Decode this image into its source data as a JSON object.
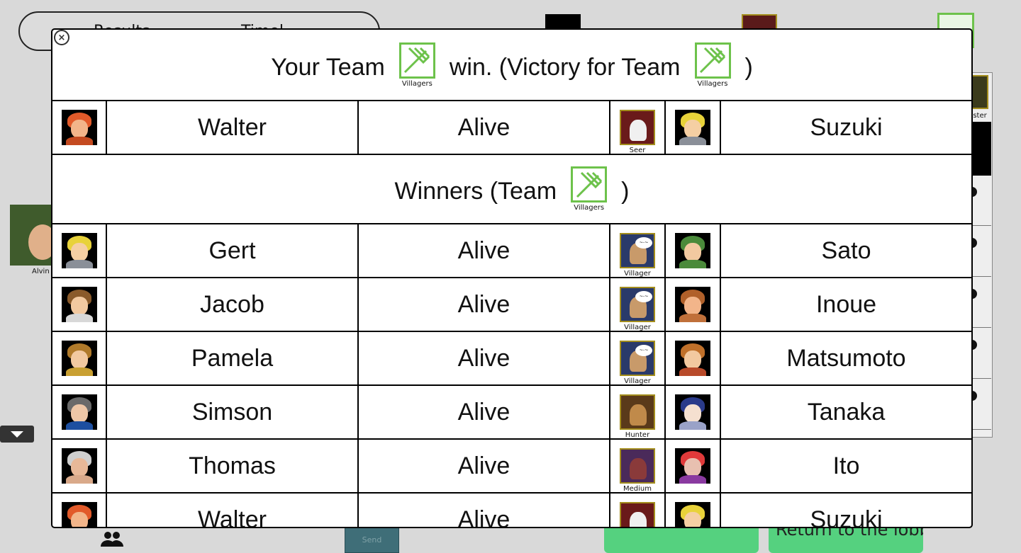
{
  "background": {
    "tabs": [
      "Results",
      "Timel"
    ],
    "side_player": "Alvin",
    "right_label": "nster",
    "send_label": "Send",
    "return_label": "Return to the lobby"
  },
  "modal": {
    "close_icon": "close-icon",
    "your_team_text": "Your Team",
    "win_text": "win. (Victory for Team",
    "close_paren": ")",
    "team_name": "Villagers",
    "winners_text": "Winners (Team",
    "team_color": "#6dc24b"
  },
  "player_rows": [
    {
      "name": "Walter",
      "status": "Alive",
      "role": "Seer",
      "owner": "Suzuki"
    },
    {
      "name": "Gert",
      "status": "Alive",
      "role": "Villager",
      "owner": "Sato"
    },
    {
      "name": "Jacob",
      "status": "Alive",
      "role": "Villager",
      "owner": "Inoue"
    },
    {
      "name": "Pamela",
      "status": "Alive",
      "role": "Villager",
      "owner": "Matsumoto"
    },
    {
      "name": "Simson",
      "status": "Alive",
      "role": "Hunter",
      "owner": "Tanaka"
    },
    {
      "name": "Thomas",
      "status": "Alive",
      "role": "Medium",
      "owner": "Ito"
    },
    {
      "name": "Walter",
      "status": "Alive",
      "role": "Seer",
      "owner": "Suzuki"
    }
  ]
}
